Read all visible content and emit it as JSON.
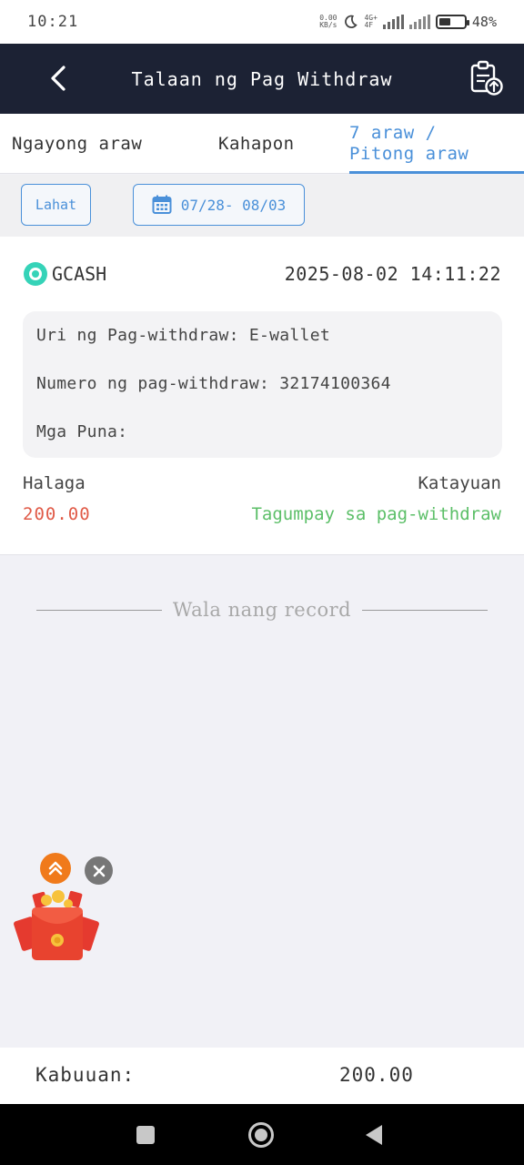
{
  "status_bar": {
    "time": "10:21",
    "speed_value": "0.00",
    "speed_unit": "KB/s",
    "network_top": "4G+",
    "network_bottom": "4F",
    "battery_level": 48,
    "battery_text": "48%"
  },
  "header": {
    "title": "Talaan ng Pag Withdraw"
  },
  "tabs": [
    {
      "label": "Ngayong araw",
      "active": false
    },
    {
      "label": "Kahapon",
      "active": false
    },
    {
      "label": "7 araw / Pitong araw",
      "active": true
    }
  ],
  "filters": {
    "all_label": "Lahat",
    "date_range": "07/28- 08/03"
  },
  "record": {
    "method": "GCASH",
    "datetime": "2025-08-02 14:11:22",
    "type_line": "Uri ng Pag-withdraw: E-wallet",
    "number_line": "Numero ng pag-withdraw: 32174100364",
    "remarks_line": "Mga Puna:",
    "amount_label": "Halaga",
    "status_label": "Katayuan",
    "amount": "200.00",
    "status": "Tagumpay sa pag-withdraw"
  },
  "no_more_text": "Wala nang record",
  "total": {
    "label": "Kabuuan:",
    "value": "200.00"
  },
  "colors": {
    "header_bg": "#1c2234",
    "accent": "#4a90d9",
    "amount": "#e05a47",
    "success": "#5cbf68"
  }
}
